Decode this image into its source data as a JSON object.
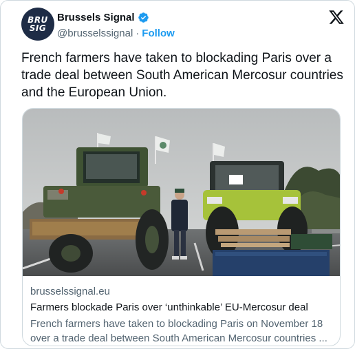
{
  "account": {
    "name": "Brussels Signal",
    "handle": "@brusselssignal",
    "separator": "·",
    "follow_label": "Follow",
    "avatar_line1": "BRU",
    "avatar_line2": "SIG",
    "avatar_color": "#1e2c46",
    "verified_icon": "verified-badge-icon"
  },
  "tweet": {
    "text": "French farmers have taken to blockading Paris over a trade deal between South American Mercosur countries and the European Union."
  },
  "link_card": {
    "domain": "brusselssignal.eu",
    "title": "Farmers blockade Paris over ‘unthinkable’ EU-Mercosur deal",
    "description": "French farmers have taken to blockading Paris on November 18 over a trade deal between South American Mercosur countries ...",
    "image_alt": "Tractors and a farmer blockading a road"
  },
  "colors": {
    "accent": "#1d9bf0",
    "text_primary": "#0f1419",
    "text_secondary": "#536471",
    "border": "#cfd9de"
  }
}
